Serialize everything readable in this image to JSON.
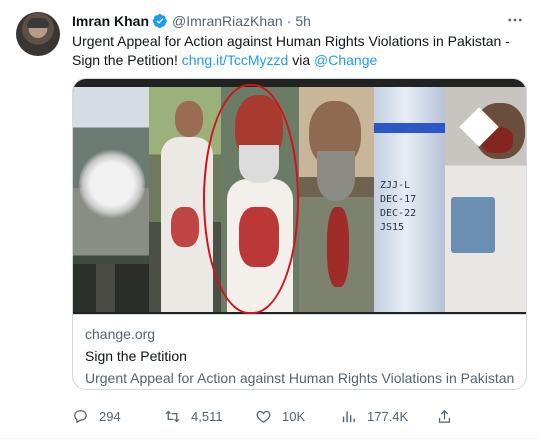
{
  "tweet": {
    "author_name": "Imran Khan",
    "handle": "@ImranRiazKhan",
    "separator": "·",
    "time": "5h",
    "text_prefix": "Urgent Appeal for Action against Human Rights Violations in Pakistan - Sign the Petition! ",
    "link_text": "chng.it/TccMyzzd",
    "via_text": " via ",
    "mention_text": "@Change"
  },
  "card": {
    "domain": "change.org",
    "title": "Sign the Petition",
    "description": "Urgent Appeal for Action against Human Rights Violations in Pakistan",
    "image_writing": "ZJJ-L\nDEC-17\nDEC-22\nJS15"
  },
  "actions": {
    "replies": "294",
    "retweets": "4,511",
    "likes": "10K",
    "views": "177.4K"
  },
  "colors": {
    "accent": "#1d9bf0",
    "text": "#0f1419",
    "secondary": "#536471",
    "border": "#cfd9de",
    "annotation_circle": "#d1121b"
  },
  "icons": {
    "verified": "verified-badge-icon",
    "more": "more-icon",
    "reply": "reply-icon",
    "retweet": "retweet-icon",
    "like": "heart-icon",
    "views": "views-icon",
    "share": "share-icon"
  }
}
